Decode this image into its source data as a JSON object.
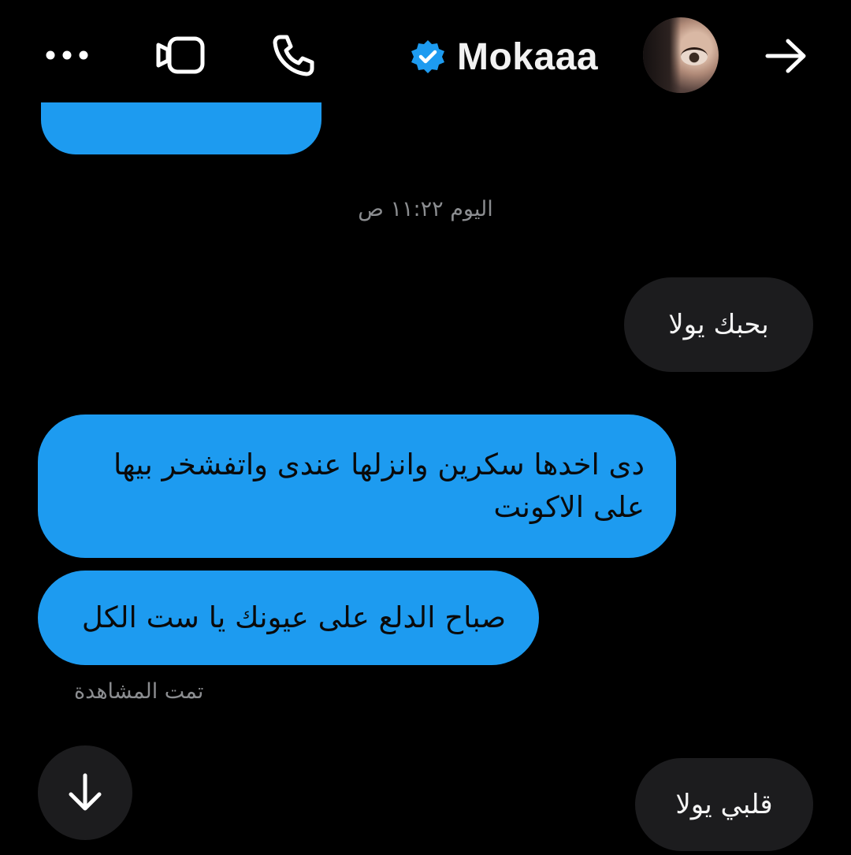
{
  "header": {
    "contact_name": "Mokaaa",
    "icons": {
      "more": "more-horizontal-icon",
      "video": "video-call-icon",
      "call": "phone-icon",
      "verified": "verified-badge-icon",
      "back": "arrow-right-icon"
    },
    "verified_color": "#1d9bf0"
  },
  "conversation": {
    "timestamp": "اليوم ١١:٢٢ ص",
    "messages": [
      {
        "direction": "incoming",
        "text": "بحبك يولا"
      },
      {
        "direction": "outgoing",
        "text": "دى اخدها سكرين وانزلها عندى واتفشخر بيها على الاكونت"
      },
      {
        "direction": "outgoing",
        "text": "صباح الدلع على عيونك يا ست الكل"
      },
      {
        "direction": "incoming",
        "text": "قلبي يولا"
      }
    ],
    "seen_label": "تمت المشاهدة",
    "scroll_down_icon": "arrow-down-icon"
  },
  "colors": {
    "background": "#000000",
    "outgoing_bubble": "#1d9bf0",
    "incoming_bubble": "#1c1c1e",
    "muted_text": "#8b8d90"
  }
}
